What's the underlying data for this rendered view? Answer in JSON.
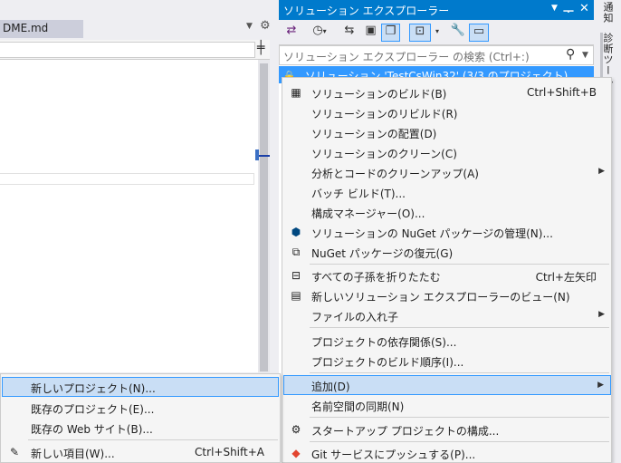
{
  "editor": {
    "tab_label": "DME.md",
    "split_icon": "split-view-icon"
  },
  "solution_explorer": {
    "title": "ソリューション エクスプローラー",
    "search_placeholder": "ソリューション エクスプローラー の検索 (Ctrl+:)",
    "selected_node": "ソリューション 'TestCsWin32' (3/3 のプロジェクト)",
    "toolbar_icons": [
      "vs-switch-view-icon",
      "history-icon",
      "sync-icon",
      "collapse-all-icon",
      "show-all-files-icon",
      "preview-selected-icon",
      "properties-wrench-icon",
      "pending-changes-icon"
    ]
  },
  "side_tabs": {
    "notifications": "通知",
    "diagnostics": "診断ツール"
  },
  "context_menu": {
    "items": [
      {
        "label": "ソリューションのビルド(B)",
        "shortcut": "Ctrl+Shift+B",
        "icon": "build-icon"
      },
      {
        "label": "ソリューションのリビルド(R)",
        "shortcut": "",
        "icon": ""
      },
      {
        "label": "ソリューションの配置(D)",
        "shortcut": "",
        "icon": ""
      },
      {
        "label": "ソリューションのクリーン(C)",
        "shortcut": "",
        "icon": ""
      },
      {
        "label": "分析とコードのクリーンアップ(A)",
        "shortcut": "",
        "icon": ""
      },
      {
        "label": "バッチ ビルド(T)...",
        "shortcut": "",
        "icon": ""
      },
      {
        "label": "構成マネージャー(O)...",
        "shortcut": "",
        "icon": ""
      },
      {
        "label": "ソリューションの NuGet パッケージの管理(N)...",
        "shortcut": "",
        "icon": "nuget-icon"
      },
      {
        "label": "NuGet パッケージの復元(G)",
        "shortcut": "",
        "icon": "package-restore-icon"
      },
      {
        "label": "すべての子孫を折りたたむ",
        "shortcut": "Ctrl+左矢印",
        "icon": "collapse-icon"
      },
      {
        "label": "新しいソリューション エクスプローラーのビュー(N)",
        "shortcut": "",
        "icon": "new-view-icon"
      },
      {
        "label": "ファイルの入れ子",
        "shortcut": "",
        "icon": ""
      },
      {
        "label": "プロジェクトの依存関係(S)...",
        "shortcut": "",
        "icon": ""
      },
      {
        "label": "プロジェクトのビルド順序(I)...",
        "shortcut": "",
        "icon": ""
      },
      {
        "label": "追加(D)",
        "shortcut": "",
        "icon": ""
      },
      {
        "label": "名前空間の同期(N)",
        "shortcut": "",
        "icon": ""
      },
      {
        "label": "スタートアップ プロジェクトの構成...",
        "shortcut": "",
        "icon": "gear-icon"
      },
      {
        "label": "Git サービスにプッシュする(P)...",
        "shortcut": "",
        "icon": "git-icon"
      }
    ]
  },
  "submenu": {
    "items": [
      {
        "label": "新しいプロジェクト(N)...",
        "shortcut": ""
      },
      {
        "label": "既存のプロジェクト(E)...",
        "shortcut": ""
      },
      {
        "label": "既存の Web サイト(B)...",
        "shortcut": ""
      },
      {
        "label": "新しい項目(W)...",
        "shortcut": "Ctrl+Shift+A"
      }
    ]
  },
  "colors": {
    "accent": "#007acc",
    "selection": "#3399ff",
    "menu_highlight": "#c9def5"
  }
}
